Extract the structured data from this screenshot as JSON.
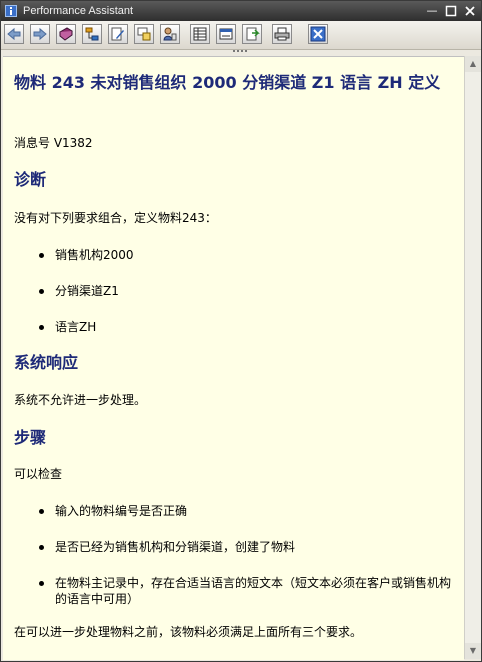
{
  "window": {
    "title": "Performance Assistant"
  },
  "icons": {
    "app": "info-icon",
    "toolbar": [
      "back-icon",
      "forward-icon",
      "book-icon",
      "structure-icon",
      "edit-icon",
      "tech-info-icon",
      "user-icon",
      "table-icon",
      "settings-icon",
      "export-icon",
      "print-icon",
      "close-icon"
    ]
  },
  "document": {
    "title": "物料 243 未对销售组织 2000 分销渠道 Z1 语言 ZH 定义",
    "message_number": "消息号 V1382",
    "diagnosis": {
      "heading": "诊断",
      "intro": "没有对下列要求组合，定义物料243：",
      "items": [
        "销售机构2000",
        "分销渠道Z1",
        "语言ZH"
      ]
    },
    "response": {
      "heading": "系统响应",
      "text": "系统不允许进一步处理。"
    },
    "procedure": {
      "heading": "步骤",
      "intro": "可以检查",
      "items": [
        "输入的物料编号是否正确",
        "是否已经为销售机构和分销渠道，创建了物料",
        "在物料主记录中，存在合适当语言的短文本（短文本必须在客户或销售机构的语言中可用）"
      ],
      "closing": "在可以进一步处理物料之前，该物料必须满足上面所有三个要求。"
    }
  }
}
